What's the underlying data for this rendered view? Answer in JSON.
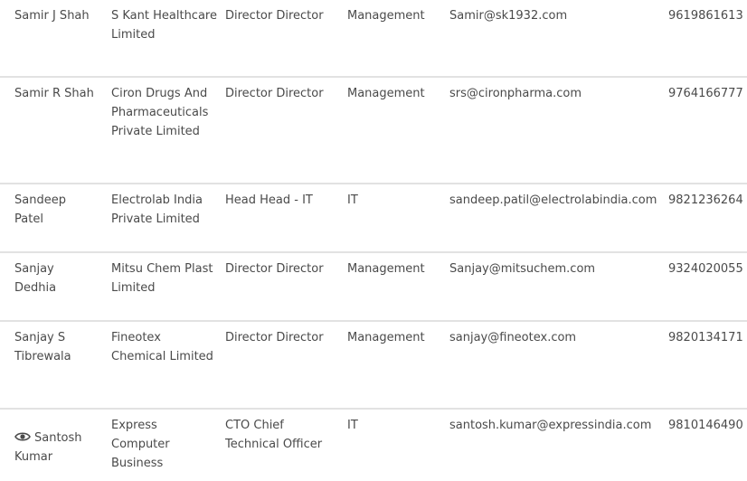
{
  "contacts": [
    {
      "name": "Samir J Shah",
      "company": "S Kant Healthcare Limited",
      "designation": "Director Director",
      "department": "Management",
      "email": "Samir@sk1932.com",
      "phone": "9619861613"
    },
    {
      "name": "Samir R Shah",
      "company": "Ciron Drugs And Pharmaceuticals Private Limited",
      "designation": "Director Director",
      "department": "Management",
      "email": "srs@cironpharma.com",
      "phone": "9764166777"
    },
    {
      "name": "Sandeep Patel",
      "company": "Electrolab India Private Limited",
      "designation": "Head Head - IT",
      "department": "IT",
      "email": "sandeep.patil@electrolabindia.com",
      "phone": "9821236264"
    },
    {
      "name": "Sanjay Dedhia",
      "company": "Mitsu Chem Plast Limited",
      "designation": "Director Director",
      "department": "Management",
      "email": "Sanjay@mitsuchem.com",
      "phone": "9324020055"
    },
    {
      "name": "Sanjay S Tibrewala",
      "company": "Fineotex Chemical Limited",
      "designation": "Director Director",
      "department": "Management",
      "email": "sanjay@fineotex.com",
      "phone": "9820134171"
    },
    {
      "name": "Santosh Kumar",
      "company": "Express Computer Business",
      "designation": "CTO Chief Technical Officer",
      "department": "IT",
      "email": "santosh.kumar@expressindia.com",
      "phone": "9810146490",
      "icon": "eye-icon"
    }
  ]
}
